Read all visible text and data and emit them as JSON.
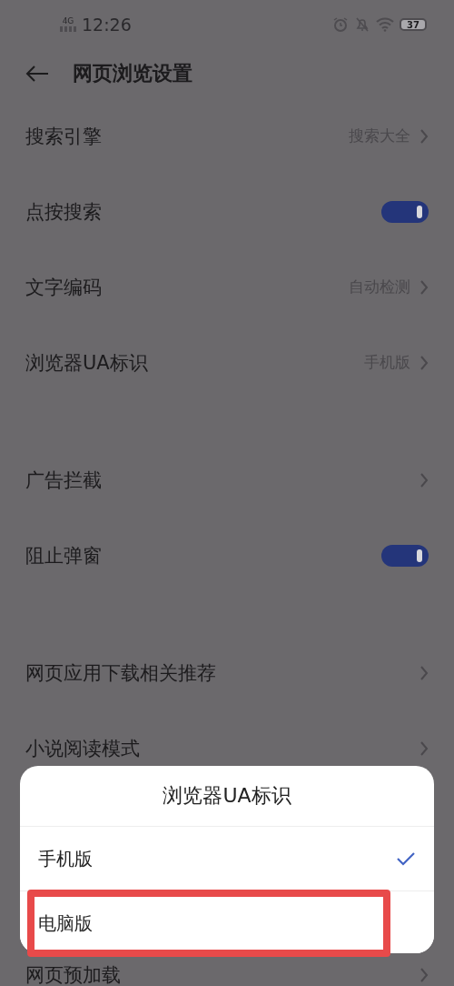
{
  "status_bar": {
    "network": "4G",
    "time": "12:26",
    "battery": "37"
  },
  "header": {
    "title": "网页浏览设置"
  },
  "groups": [
    {
      "items": [
        {
          "kind": "link",
          "label": "搜索引擎",
          "value": "搜索大全"
        },
        {
          "kind": "toggle",
          "label": "点按搜索",
          "on": true
        },
        {
          "kind": "link",
          "label": "文字编码",
          "value": "自动检测"
        },
        {
          "kind": "link",
          "label": "浏览器UA标识",
          "value": "手机版"
        }
      ]
    },
    {
      "items": [
        {
          "kind": "link",
          "label": "广告拦截"
        },
        {
          "kind": "toggle",
          "label": "阻止弹窗",
          "on": true
        }
      ]
    },
    {
      "items": [
        {
          "kind": "link",
          "label": "网页应用下载相关推荐"
        },
        {
          "kind": "link",
          "label": "小说阅读模式"
        }
      ]
    },
    {
      "items": [
        {
          "kind": "link",
          "label": "网页预加载"
        }
      ]
    }
  ],
  "sheet": {
    "title": "浏览器UA标识",
    "options": [
      {
        "label": "手机版",
        "selected": true,
        "highlighted": false
      },
      {
        "label": "电脑版",
        "selected": false,
        "highlighted": true
      }
    ]
  }
}
